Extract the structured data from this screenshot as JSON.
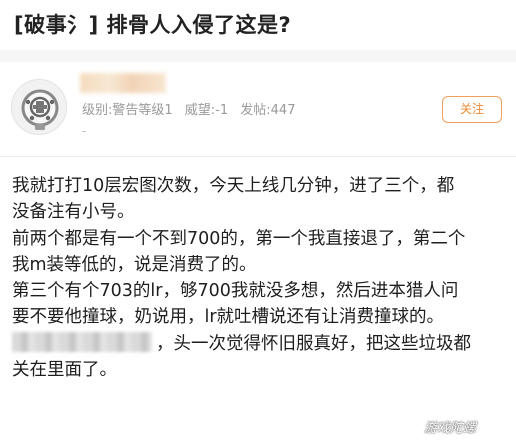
{
  "header": {
    "title": "[破事氵] 排骨人入侵了这是?"
  },
  "user": {
    "level": "级别:警告等级1",
    "reputation": "威望:-1",
    "posts": "发帖:447",
    "dash": "-",
    "follow_label": "关注",
    "avatar_icon": "diving-helmet-icon"
  },
  "post": {
    "lines": [
      "我就打打10层宏图次数，今天上线几分钟，进了三个，都",
      "没备注有小号。",
      "前两个都是有一个不到700的，第一个我直接退了，第二个",
      "我m装等低的，说是消费了的。",
      "第三个有个703的lr，够700我就没多想，然后进本猎人问",
      "要不要他撞球，奶说用，lr就吐槽说还有让消费撞球的。"
    ],
    "line7_rest": "，头一次觉得怀旧服真好，把这些垃圾都",
    "line8": "关在里面了。"
  },
  "watermark": "游戏陀螺",
  "colors": {
    "accent": "#ef8a2e",
    "meta_text": "#9a9a9a"
  }
}
